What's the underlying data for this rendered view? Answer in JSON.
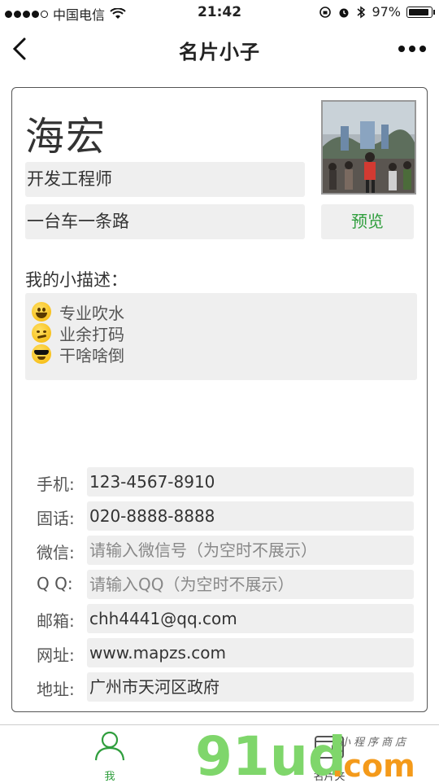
{
  "status_bar": {
    "carrier": "中国电信",
    "time": "21:42",
    "battery": "97%"
  },
  "nav": {
    "title": "名片小子"
  },
  "profile": {
    "name": "海宏",
    "job": "开发工程师",
    "motto": "一台车一条路",
    "preview_label": "预览",
    "description_label": "我的小描述：",
    "description_lines": [
      {
        "emoji": "grinning-face-icon",
        "text": "专业吹水"
      },
      {
        "emoji": "smirking-face-icon",
        "text": "业余打码"
      },
      {
        "emoji": "sunglasses-face-icon",
        "text": "干啥啥倒"
      }
    ]
  },
  "contact": {
    "phone": {
      "label": "手机:",
      "value": "123-4567-8910"
    },
    "landline": {
      "label": "固话:",
      "value": "020-8888-8888"
    },
    "wechat": {
      "label": "微信:",
      "placeholder": "请输入微信号（为空时不展示）"
    },
    "qq": {
      "label": "Q Q:",
      "placeholder": "请输入QQ（为空时不展示）"
    },
    "email": {
      "label": "邮箱:",
      "value": "chh4441@qq.com"
    },
    "website": {
      "label": "网址:",
      "value": "www.mapzs.com"
    },
    "address": {
      "label": "地址:",
      "value": "广州市天河区政府"
    }
  },
  "tab_bar": {
    "me_label": "我",
    "card_label": "名片夹"
  },
  "watermark": {
    "brand": "91ud",
    "domain": ".com",
    "tagline": "小程序商店"
  },
  "colors": {
    "accent": "#2f9e3d",
    "field_bg": "#efefef",
    "watermark_green": "#7fd66b",
    "watermark_orange": "#f49a1a"
  }
}
